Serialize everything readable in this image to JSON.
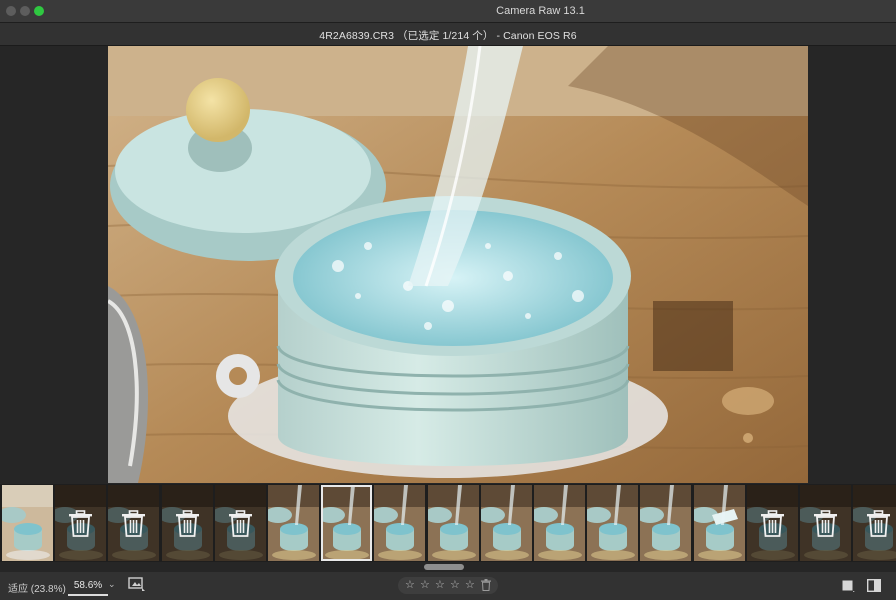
{
  "window": {
    "title": "Camera Raw 13.1"
  },
  "file_info": "4R2A6839.CR3 （已选定 1/214 个） - Canon EOS R6",
  "filmstrip": {
    "thumbnails": [
      {
        "kind": "photo",
        "style": "bright"
      },
      {
        "kind": "deleted"
      },
      {
        "kind": "deleted"
      },
      {
        "kind": "deleted"
      },
      {
        "kind": "deleted"
      },
      {
        "kind": "photo"
      },
      {
        "kind": "photo",
        "selected": true
      },
      {
        "kind": "photo"
      },
      {
        "kind": "photo"
      },
      {
        "kind": "photo"
      },
      {
        "kind": "photo"
      },
      {
        "kind": "photo"
      },
      {
        "kind": "photo"
      },
      {
        "kind": "photo",
        "style": "tilted"
      },
      {
        "kind": "deleted"
      },
      {
        "kind": "deleted"
      },
      {
        "kind": "deleted"
      }
    ]
  },
  "bottom": {
    "zoom_fit": "适应 (23.8%)",
    "zoom_value": "58.6%",
    "zoom_chevron": "⌄",
    "stars": [
      "☆",
      "☆",
      "☆",
      "☆",
      "☆"
    ]
  },
  "colors": {
    "accent_green": "#2fc841",
    "background": "#262626"
  }
}
